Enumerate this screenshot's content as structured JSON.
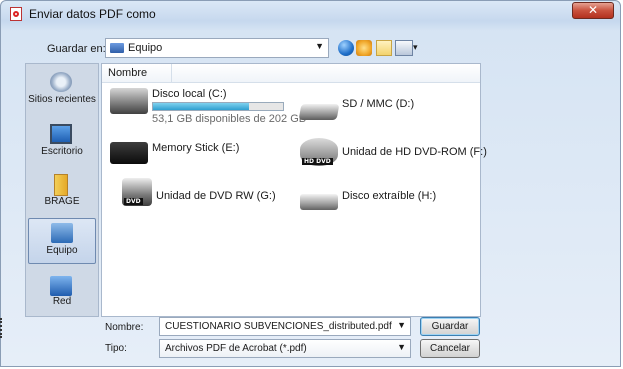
{
  "window": {
    "title": "Enviar datos PDF como",
    "close_glyph": "✕"
  },
  "toolbar": {
    "lookin_label": "Guardar en:",
    "lookin_value": "Equipo",
    "lookin_icon": "computer-icon",
    "buttons": [
      "back-icon",
      "up-folder-icon",
      "new-folder-icon",
      "views-menu-icon"
    ]
  },
  "places": [
    {
      "label": "Sitios recientes",
      "icon": "recent-places-icon"
    },
    {
      "label": "Escritorio",
      "icon": "desktop-icon"
    },
    {
      "label": "BRAGE",
      "icon": "user-folder-icon"
    },
    {
      "label": "Equipo",
      "icon": "computer-icon",
      "selected": true
    },
    {
      "label": "Red",
      "icon": "network-icon"
    }
  ],
  "list": {
    "column_header": "Nombre",
    "items": [
      {
        "name": "Disco local (C:)",
        "subtext": "53,1 GB disponibles de 202 GB",
        "usage_fraction": 0.74,
        "icon": "local-disk-icon"
      },
      {
        "name": "SD / MMC (D:)",
        "icon": "sd-card-drive-icon"
      },
      {
        "name": "Memory Stick (E:)",
        "icon": "memory-stick-icon"
      },
      {
        "name": "Unidad de HD DVD-ROM (F:)",
        "icon": "hd-dvd-drive-icon",
        "badge": "HD DVD"
      },
      {
        "name": "Unidad de DVD RW (G:)",
        "icon": "dvd-drive-icon",
        "badge": "DVD"
      },
      {
        "name": "Disco extraíble (H:)",
        "icon": "removable-disk-icon"
      }
    ]
  },
  "bottom": {
    "filename_label": "Nombre:",
    "filename_value": "CUESTIONARIO SUBVENCIONES_distributed.pdf",
    "type_label": "Tipo:",
    "type_value": "Archivos PDF de Acrobat (*.pdf)",
    "save_button": "Guardar",
    "cancel_button": "Cancelar"
  }
}
